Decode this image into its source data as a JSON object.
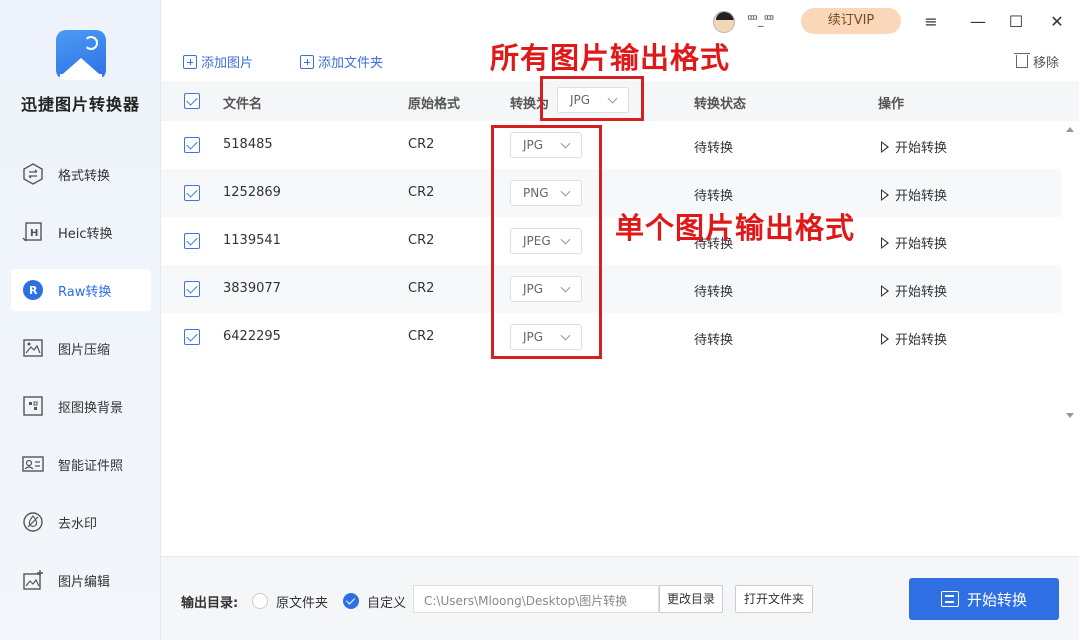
{
  "app": {
    "name": "迅捷图片转换器"
  },
  "sidebar": {
    "items": [
      {
        "label": "格式转换",
        "icon": "format-convert-icon",
        "active": false
      },
      {
        "label": "Heic转换",
        "icon": "heic-icon",
        "active": false
      },
      {
        "label": "Raw转换",
        "icon": "raw-icon",
        "active": true
      },
      {
        "label": "图片压缩",
        "icon": "compress-icon",
        "active": false
      },
      {
        "label": "抠图换背景",
        "icon": "cutout-icon",
        "active": false
      },
      {
        "label": "智能证件照",
        "icon": "id-photo-icon",
        "active": false
      },
      {
        "label": "去水印",
        "icon": "watermark-icon",
        "active": false
      },
      {
        "label": "图片编辑",
        "icon": "image-edit-icon",
        "active": false
      }
    ]
  },
  "topbar": {
    "username": "罒_罒",
    "vip_label": "续订VIP",
    "menu_icon": "≡",
    "minimize_icon": "—",
    "maximize_icon": "☐",
    "close_icon": "✕"
  },
  "toolbar": {
    "add_image": "添加图片",
    "add_folder": "添加文件夹",
    "remove": "移除"
  },
  "table": {
    "headers": {
      "filename": "文件名",
      "original_format": "原始格式",
      "convert_to": "转换为",
      "status": "转换状态",
      "action": "操作"
    },
    "global_format": "JPG",
    "rows": [
      {
        "filename": "518485",
        "original_format": "CR2",
        "convert_to": "JPG",
        "status": "待转换",
        "action": "开始转换"
      },
      {
        "filename": "1252869",
        "original_format": "CR2",
        "convert_to": "PNG",
        "status": "待转换",
        "action": "开始转换"
      },
      {
        "filename": "1139541",
        "original_format": "CR2",
        "convert_to": "JPEG",
        "status": "待转换",
        "action": "开始转换"
      },
      {
        "filename": "3839077",
        "original_format": "CR2",
        "convert_to": "JPG",
        "status": "待转换",
        "action": "开始转换"
      },
      {
        "filename": "6422295",
        "original_format": "CR2",
        "convert_to": "JPG",
        "status": "待转换",
        "action": "开始转换"
      }
    ]
  },
  "annotations": {
    "all_format": "所有图片输出格式",
    "single_format": "单个图片输出格式",
    "color": "#d42020"
  },
  "bottom": {
    "output_label": "输出目录:",
    "option_original": "原文件夹",
    "option_custom": "自定义",
    "path": "C:\\Users\\Mloong\\Desktop\\图片转换",
    "change_dir": "更改目录",
    "open_folder": "打开文件夹",
    "start": "开始转换"
  },
  "colors": {
    "accent": "#2f6fe4",
    "vip": "#fbd7b9"
  }
}
